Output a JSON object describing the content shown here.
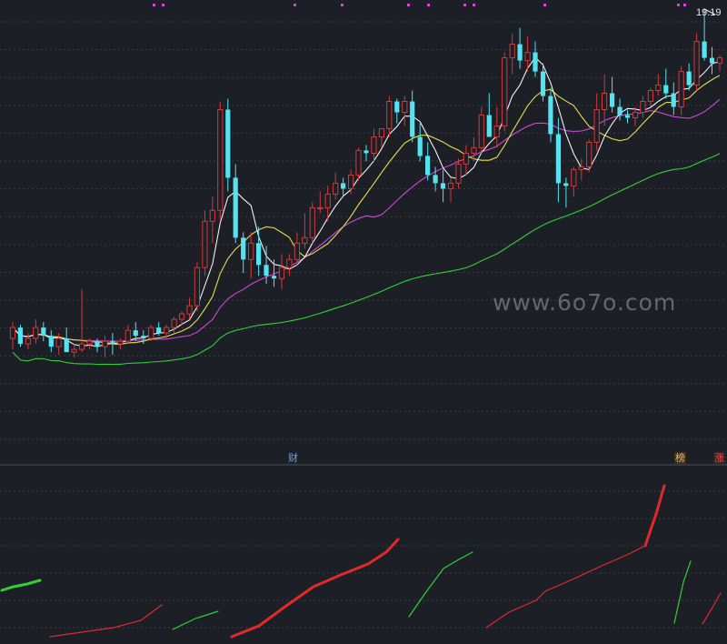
{
  "chart_data": {
    "type": "candlestick",
    "main_panel": {
      "high_label": "19.19",
      "ohlc": [
        [
          7.1,
          7.7,
          6.7,
          7.5
        ],
        [
          7.5,
          7.6,
          6.8,
          6.9
        ],
        [
          6.9,
          7.3,
          6.7,
          7.1
        ],
        [
          7.1,
          7.8,
          6.9,
          7.5
        ],
        [
          7.5,
          7.7,
          7.0,
          7.2
        ],
        [
          7.2,
          7.4,
          6.6,
          6.8
        ],
        [
          6.8,
          7.3,
          6.5,
          7.1
        ],
        [
          7.1,
          7.5,
          6.7,
          6.6
        ],
        [
          6.6,
          6.9,
          6.4,
          6.7
        ],
        [
          6.7,
          8.9,
          6.6,
          6.9
        ],
        [
          6.9,
          7.1,
          6.7,
          7.0
        ],
        [
          7.0,
          7.1,
          6.6,
          6.8
        ],
        [
          6.8,
          7.2,
          6.4,
          7.0
        ],
        [
          7.0,
          7.3,
          6.5,
          6.9
        ],
        [
          6.9,
          7.1,
          6.7,
          7.0
        ],
        [
          7.0,
          7.6,
          6.9,
          7.4
        ],
        [
          7.4,
          7.7,
          7.0,
          7.2
        ],
        [
          7.2,
          7.4,
          6.9,
          7.1
        ],
        [
          7.1,
          7.6,
          7.0,
          7.5
        ],
        [
          7.5,
          7.7,
          7.2,
          7.3
        ],
        [
          7.3,
          7.6,
          7.1,
          7.5
        ],
        [
          7.5,
          7.9,
          7.3,
          7.8
        ],
        [
          7.8,
          8.1,
          7.6,
          8.0
        ],
        [
          8.0,
          8.6,
          7.8,
          8.3
        ],
        [
          8.3,
          9.9,
          8.1,
          9.7
        ],
        [
          9.7,
          11.8,
          9.4,
          11.4
        ],
        [
          11.4,
          12.3,
          10.6,
          11.8
        ],
        [
          11.8,
          15.8,
          11.4,
          15.5
        ],
        [
          15.5,
          15.9,
          12.5,
          13.0
        ],
        [
          13.0,
          13.5,
          10.6,
          10.8
        ],
        [
          10.8,
          11.0,
          9.5,
          10.0
        ],
        [
          10.0,
          11.0,
          9.3,
          10.6
        ],
        [
          10.6,
          11.2,
          9.4,
          9.8
        ],
        [
          9.8,
          10.5,
          9.1,
          9.4
        ],
        [
          9.4,
          10.0,
          9.0,
          9.3
        ],
        [
          9.3,
          10.2,
          8.9,
          9.7
        ],
        [
          9.7,
          10.2,
          9.4,
          10.0
        ],
        [
          10.0,
          11.0,
          9.8,
          10.6
        ],
        [
          10.6,
          11.7,
          10.4,
          10.8
        ],
        [
          10.8,
          12.1,
          10.6,
          11.9
        ],
        [
          11.9,
          12.5,
          11.7,
          11.9
        ],
        [
          11.9,
          12.7,
          11.4,
          12.4
        ],
        [
          12.4,
          13.2,
          12.2,
          12.8
        ],
        [
          12.8,
          13.0,
          12.3,
          12.6
        ],
        [
          12.6,
          13.3,
          12.4,
          13.1
        ],
        [
          13.1,
          14.1,
          12.9,
          14.0
        ],
        [
          14.0,
          14.2,
          13.6,
          13.9
        ],
        [
          13.9,
          14.8,
          13.6,
          14.5
        ],
        [
          14.5,
          14.8,
          14.1,
          14.8
        ],
        [
          14.8,
          16.0,
          14.5,
          15.8
        ],
        [
          15.8,
          15.9,
          15.0,
          15.4
        ],
        [
          15.4,
          16.0,
          14.9,
          15.8
        ],
        [
          15.8,
          16.2,
          14.3,
          14.5
        ],
        [
          14.5,
          15.0,
          13.6,
          13.8
        ],
        [
          13.8,
          14.3,
          12.9,
          13.1
        ],
        [
          13.1,
          13.4,
          12.5,
          12.8
        ],
        [
          12.8,
          13.3,
          12.1,
          12.6
        ],
        [
          12.6,
          13.0,
          12.1,
          12.8
        ],
        [
          12.8,
          13.7,
          12.6,
          13.5
        ],
        [
          13.5,
          14.2,
          13.1,
          13.9
        ],
        [
          13.9,
          14.5,
          13.6,
          14.1
        ],
        [
          14.1,
          15.6,
          13.9,
          15.3
        ],
        [
          15.3,
          16.1,
          14.5,
          14.5
        ],
        [
          14.5,
          15.6,
          14.1,
          14.9
        ],
        [
          14.9,
          17.6,
          14.7,
          17.4
        ],
        [
          17.4,
          18.3,
          16.8,
          17.9
        ],
        [
          17.9,
          18.5,
          17.0,
          17.3
        ],
        [
          17.3,
          18.2,
          16.9,
          17.6
        ],
        [
          17.6,
          18.0,
          16.7,
          16.9
        ],
        [
          16.9,
          17.2,
          15.8,
          16.0
        ],
        [
          16.0,
          16.3,
          14.3,
          14.6
        ],
        [
          14.6,
          15.2,
          12.1,
          12.8
        ],
        [
          12.8,
          13.0,
          11.9,
          12.7
        ],
        [
          12.7,
          13.4,
          12.3,
          13.3
        ],
        [
          13.3,
          13.7,
          12.9,
          13.4
        ],
        [
          13.4,
          14.4,
          13.2,
          14.3
        ],
        [
          14.3,
          16.1,
          14.0,
          15.5
        ],
        [
          15.5,
          16.8,
          14.9,
          16.1
        ],
        [
          16.1,
          16.7,
          15.4,
          15.6
        ],
        [
          15.6,
          15.9,
          15.1,
          15.3
        ],
        [
          15.3,
          15.5,
          15.0,
          15.2
        ],
        [
          15.2,
          15.6,
          14.9,
          15.4
        ],
        [
          15.4,
          16.0,
          15.2,
          15.8
        ],
        [
          15.8,
          16.3,
          15.6,
          16.2
        ],
        [
          16.2,
          16.8,
          16.0,
          16.4
        ],
        [
          16.4,
          17.0,
          15.9,
          16.1
        ],
        [
          16.1,
          16.5,
          15.3,
          15.6
        ],
        [
          15.6,
          17.1,
          15.3,
          16.9
        ],
        [
          16.9,
          17.2,
          16.2,
          16.4
        ],
        [
          16.4,
          18.3,
          16.2,
          18.0
        ],
        [
          18.0,
          19.19,
          17.3,
          17.4
        ],
        [
          17.4,
          17.8,
          16.8,
          17.2
        ],
        [
          17.2,
          17.5,
          16.9,
          17.4
        ]
      ]
    },
    "sub_panel": {
      "badges": [
        {
          "text": "财",
          "color": "#6fa8dc"
        },
        {
          "text": "榜",
          "color": "#ffb74d"
        },
        {
          "text": "涨",
          "color": "#ef5350"
        }
      ]
    },
    "colors": {
      "up": "#d23a3a",
      "down": "#54e3f0",
      "ma_white": "#f2f2f2",
      "ma_yellow": "#e3e04a",
      "ma_magenta": "#d147d6",
      "ma_green": "#2fd134",
      "grid": "#3a3e4a",
      "sub_red": "#e02a2a",
      "sub_green": "#2fd134"
    }
  },
  "watermark": "www.6o7o.com"
}
